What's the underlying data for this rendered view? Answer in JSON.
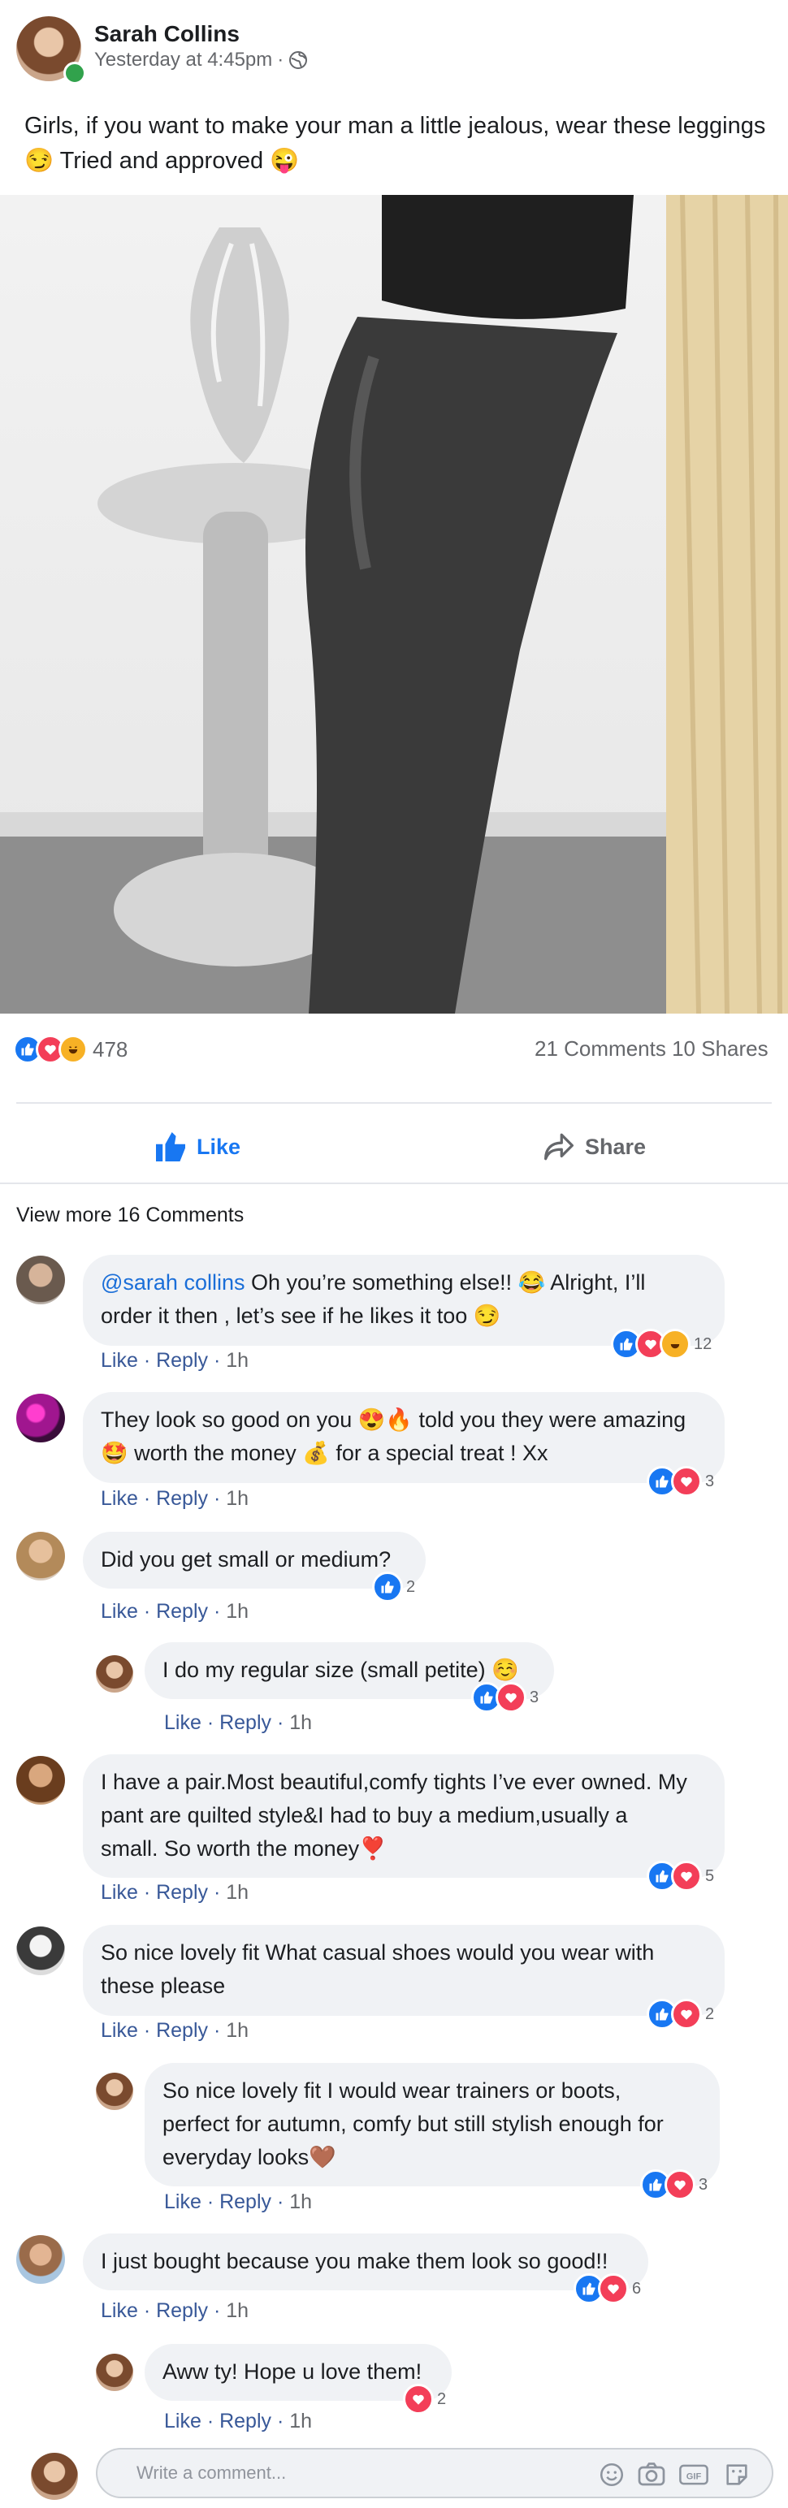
{
  "post": {
    "author": "Sarah Collins",
    "timestamp": "Yesterday at 4:45pm",
    "privacy_icon": "globe-icon",
    "text_line1": "Girls, if you want to make your man a little jealous, wear these leggings",
    "text_line2_emoji": "😏",
    "text_line2": "Tried and approved",
    "text_line2_emoji_end": "😜"
  },
  "stats": {
    "reaction_count": "478",
    "comments": "21 Comments",
    "shares": "10 Shares"
  },
  "actions": {
    "like_label": "Like",
    "share_label": "Share"
  },
  "view_more": "View more 16 Comments",
  "link_like": "Like",
  "link_reply": "Reply",
  "link_sep": " · ",
  "comments": [
    {
      "mention": "@sarah collins",
      "line1": " Oh you’re something else!! 😂 Alright, I’ll",
      "line2": "order it then , let’s see if he likes it too 😏",
      "time": "1h",
      "count": "12"
    },
    {
      "line1": "They look so good on you 😍🔥 told you they were amazing",
      "line2": "🤩 worth the money 💰 for a special treat ! Xx",
      "time": "1h",
      "count": "3"
    },
    {
      "line1": "Did you get small or medium?",
      "time": "1h",
      "count": "2"
    },
    {
      "line1": "I do my regular size (small petite) ☺️",
      "time": "1h",
      "count": "3"
    },
    {
      "line1": "I have a pair.Most beautiful,comfy tights I’ve ever owned. My",
      "line2": "pant are quilted style&I had to buy a medium,usually a",
      "line3": "small. So worth the money❣️",
      "time": "1h",
      "count": "5"
    },
    {
      "line1": "So nice lovely fit What casual shoes would you wear with",
      "line2": "these please",
      "time": "1h",
      "count": "2"
    },
    {
      "line1": "So nice lovely fit I would wear trainers or boots,",
      "line2": "perfect for autumn, comfy but still stylish enough for",
      "line3": "everyday looks🤎",
      "time": "1h",
      "count": "3"
    },
    {
      "line1": "I just bought because you make them look so good!!",
      "time": "1h",
      "count": "6"
    },
    {
      "line1": "Aww ty! Hope u love them!",
      "time": "1h",
      "count": "2"
    }
  ],
  "composer": {
    "placeholder": "Write a comment...",
    "icons": [
      "emoji-icon",
      "camera-icon",
      "gif-icon",
      "sticker-icon"
    ]
  },
  "colors": {
    "accent": "#1877f2",
    "like": "#1877f2",
    "love": "#f33e58",
    "haha": "#f7b125",
    "link": "#385898",
    "online": "#31a24c"
  }
}
